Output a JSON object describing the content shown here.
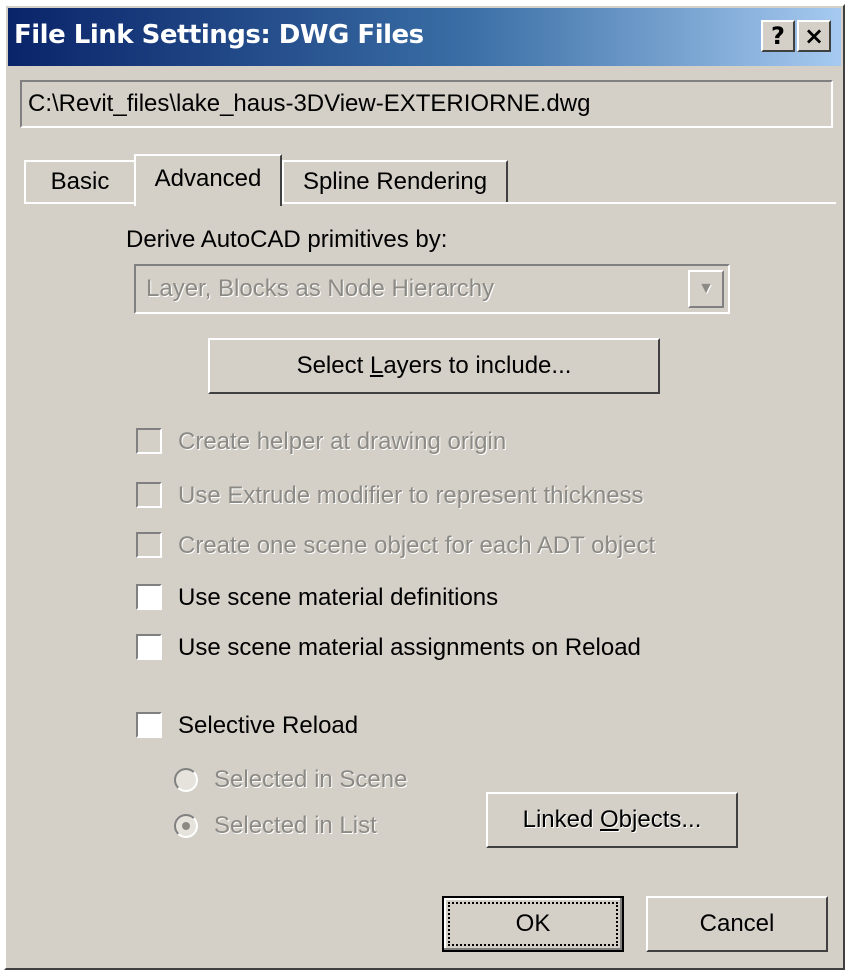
{
  "window": {
    "title": "File Link Settings: DWG Files",
    "help_label": "?",
    "close_label": "×"
  },
  "file_path": "C:\\Revit_files\\lake_haus-3DView-EXTERIORNE.dwg",
  "tabs": [
    {
      "label": "Basic",
      "active": false
    },
    {
      "label": "Advanced",
      "active": true
    },
    {
      "label": "Spline Rendering",
      "active": false
    }
  ],
  "derive": {
    "label": "Derive AutoCAD primitives by:",
    "selected": "Layer, Blocks as Node Hierarchy",
    "enabled": false
  },
  "select_layers": {
    "pre": "Select ",
    "accel": "L",
    "post": "ayers to include..."
  },
  "options": [
    {
      "label": "Create helper at drawing origin",
      "checked": false,
      "enabled": false
    },
    {
      "label": "Use Extrude modifier to represent thickness",
      "checked": false,
      "enabled": false
    },
    {
      "label": "Create one scene object for each ADT object",
      "checked": false,
      "enabled": false
    },
    {
      "label": "Use scene material definitions",
      "checked": false,
      "enabled": true
    },
    {
      "label": "Use scene material assignments on Reload",
      "checked": false,
      "enabled": true
    }
  ],
  "selective_reload": {
    "label": "Selective Reload",
    "checked": false,
    "radios": [
      {
        "label": "Selected in Scene",
        "selected": false,
        "enabled": false
      },
      {
        "label": "Selected in List",
        "selected": true,
        "enabled": false
      }
    ],
    "linked_objects": {
      "pre": "Linked ",
      "accel": "O",
      "post": "bjects..."
    }
  },
  "buttons": {
    "ok": "OK",
    "cancel": "Cancel"
  },
  "colors": {
    "title_gradient_start": "#0a246a",
    "title_gradient_end": "#a6caf0",
    "dialog_face": "#d4d0c8",
    "disabled_text": "#8c8a85"
  }
}
